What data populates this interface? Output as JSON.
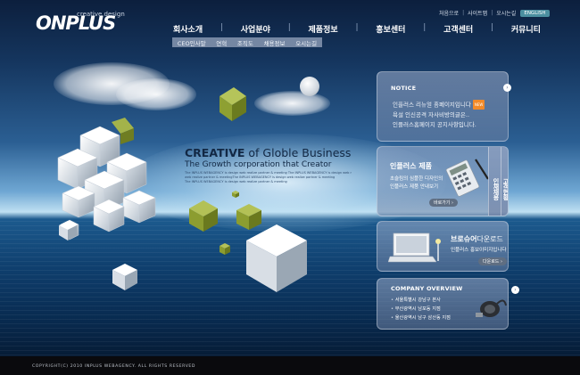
{
  "header": {
    "logo_text": "ONPLUS",
    "logo_tagline": "creative design",
    "util_links": [
      "처음으로",
      "사이트맵",
      "오시는길"
    ],
    "lang_button": "ENGLISH",
    "gnb": [
      "회사소개",
      "사업분야",
      "제품정보",
      "홍보센터",
      "고객센터",
      "커뮤니티"
    ],
    "lnb": [
      "CEO인사말",
      "연혁",
      "조직도",
      "채용정보",
      "오시는길"
    ]
  },
  "hero": {
    "headline_bold": "CREATIVE",
    "headline_rest": " of Globle Business",
    "subhead": "The Growth corporation that Creator",
    "fine_print": [
      "The INPLUS WEBAGENCY is design web realize partner & meeting The INPLUS WEBAGENCY is design web r",
      "web realize partner & meetingThe INPLUS WEBAGENCY is design web realize partner & meeting",
      "The INPLUS WEBAGENCY is design web realize partner & meeting"
    ]
  },
  "notice": {
    "title": "NOTICE",
    "items": [
      "인플러스 리뉴얼 홈페이지입니다",
      "욕설 인신공격 자사비방의글은..",
      "인플러스홈페이지 공지사항입니다."
    ],
    "new_badge": "NEW",
    "more": "›"
  },
  "product": {
    "title": "인플러스 제품",
    "desc": [
      "초슬림의 심플한 디자인의",
      "인플러스 제품 안내보기"
    ],
    "button": "바로가기 ›",
    "tabs": [
      "인재채용",
      "고객현황"
    ]
  },
  "brochure": {
    "title_bold": "브로슈어",
    "title_thin": "다운로드",
    "desc": "인플러스 홍보이미지입니다",
    "button": "다운로드 ›"
  },
  "company": {
    "title": "COMPANY OVERVIEW",
    "items": [
      "서울특별시 강남구 본사",
      "부산광역시 남포동 지점",
      "울산광역시 남구 삼산동 지점"
    ],
    "more": "›"
  },
  "footer": {
    "copyright": "COPYRIGHT(C) 2010 INPLUS WEBAGENCY. ALL RIGHTS RESERVED"
  },
  "colors": {
    "sky_top": "#0c1f3d",
    "horizon": "#bfe0f2",
    "sea": "#082a4f",
    "lnb_bar": "#7587a3",
    "new_badge": "#f28a28",
    "lang_button": "#4b8fa0"
  },
  "icons": [
    "more-arrow-icon",
    "laptop-icon",
    "phone-icon",
    "pen-icon",
    "calculator-icon",
    "lamp-icon",
    "cable-icon"
  ]
}
